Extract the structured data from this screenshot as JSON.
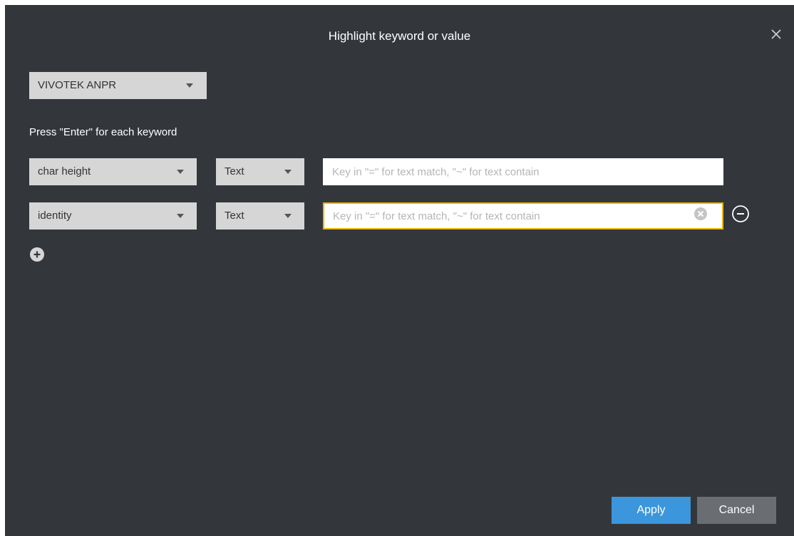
{
  "dialog": {
    "title": "Highlight keyword or value",
    "close_icon": "close-icon"
  },
  "source_select": {
    "value": "VIVOTEK ANPR"
  },
  "hint": "Press \"Enter\" for each keyword",
  "rows": [
    {
      "field": "char height",
      "type": "Text",
      "value": "",
      "placeholder": "Key in \"=\" for text match, \"~\" for text contain"
    },
    {
      "field": "identity",
      "type": "Text",
      "value": "",
      "placeholder": "Key in \"=\" for text match, \"~\" for text contain",
      "focused": true
    }
  ],
  "icons": {
    "clear": "clear-input-icon",
    "remove": "remove-row-icon",
    "add": "add-row-icon",
    "dropdown": "chevron-down-icon"
  },
  "buttons": {
    "apply": "Apply",
    "cancel": "Cancel"
  },
  "colors": {
    "background": "#33373c",
    "accent": "#3b96db",
    "focus": "#f0b400",
    "select_bg": "#d6d6d6",
    "cancel_bg": "#6a6e73"
  }
}
